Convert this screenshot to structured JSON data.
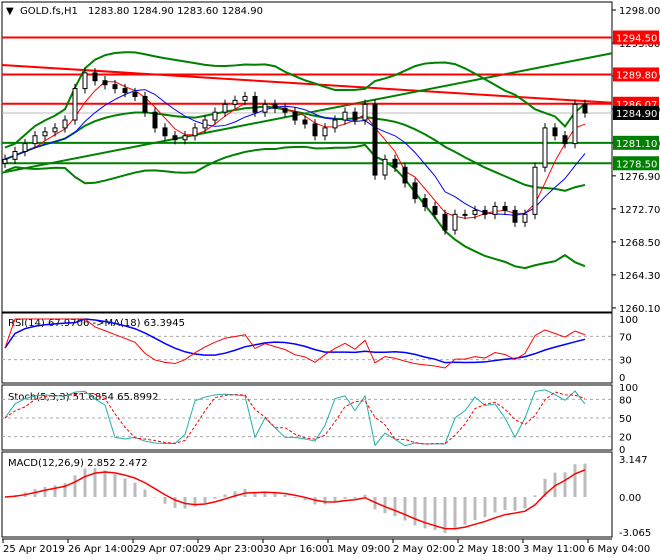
{
  "header": {
    "symbol": "GOLD.fs,H1",
    "ohlc": "1283.80 1284.90 1283.60 1284.90"
  },
  "chart_data": {
    "type": "candlestick",
    "title": "GOLD.fs,H1",
    "price_axis": {
      "ticks": [
        1298.0,
        1293.8,
        1289.6,
        1285.4,
        1281.1,
        1276.9,
        1272.7,
        1268.5,
        1264.3,
        1260.1
      ],
      "ylim": [
        1260.1,
        1298.0
      ]
    },
    "time_labels": [
      "25 Apr 2019",
      "26 Apr 14:00",
      "29 Apr 07:00",
      "29 Apr 23:00",
      "30 Apr 16:00",
      "1 May 09:00",
      "2 May 02:00",
      "2 May 18:00",
      "3 May 11:00",
      "6 May 04:00"
    ],
    "close": [
      1279,
      1280,
      1281,
      1282,
      1282.5,
      1283,
      1284,
      1288,
      1290,
      1289,
      1288.5,
      1288,
      1287.5,
      1287,
      1285,
      1283,
      1282,
      1281.5,
      1282,
      1283,
      1284,
      1285,
      1286,
      1286.5,
      1287,
      1285,
      1286,
      1285.5,
      1285,
      1284,
      1283.5,
      1282,
      1283,
      1284,
      1285,
      1284,
      1286,
      1277,
      1279,
      1278,
      1276,
      1274,
      1273,
      1272,
      1270,
      1272,
      1272,
      1272.5,
      1272,
      1273,
      1272.5,
      1271,
      1272,
      1278,
      1283,
      1282,
      1281,
      1286,
      1284.9
    ],
    "levels": [
      {
        "value": 1294.5,
        "label": "1294.50",
        "color": "#ff0000"
      },
      {
        "value": 1289.8,
        "label": "1289.80",
        "color": "#ff0000"
      },
      {
        "value": 1286.07,
        "label": "1286.07",
        "color": "#ff0000"
      },
      {
        "value": 1281.1,
        "label": "1281.10",
        "color": "#008000"
      },
      {
        "value": 1278.5,
        "label": "1278.50",
        "color": "#008000"
      }
    ],
    "current_price": {
      "value": 1284.9,
      "label": "1284.90"
    },
    "trendlines": [
      {
        "color": "#ff0000",
        "from": 1291.0,
        "to": 1286.2
      },
      {
        "color": "#008000",
        "from": 1277.3,
        "to": 1292.5
      }
    ],
    "rsi": {
      "label": "RSI(14) 67.9706  ->MA(18) 63.3945",
      "ticks": [
        "100",
        "70",
        "30",
        "0"
      ]
    },
    "stoch": {
      "label": "Stoch(5,3,3) 51.6854 65.8992",
      "ticks": [
        "100",
        "80",
        "50",
        "20",
        "0"
      ]
    },
    "macd": {
      "label": "MACD(12,26,9) 2.852 2.472",
      "ticks": [
        "3.147",
        "0.00",
        "-3.065"
      ]
    }
  }
}
